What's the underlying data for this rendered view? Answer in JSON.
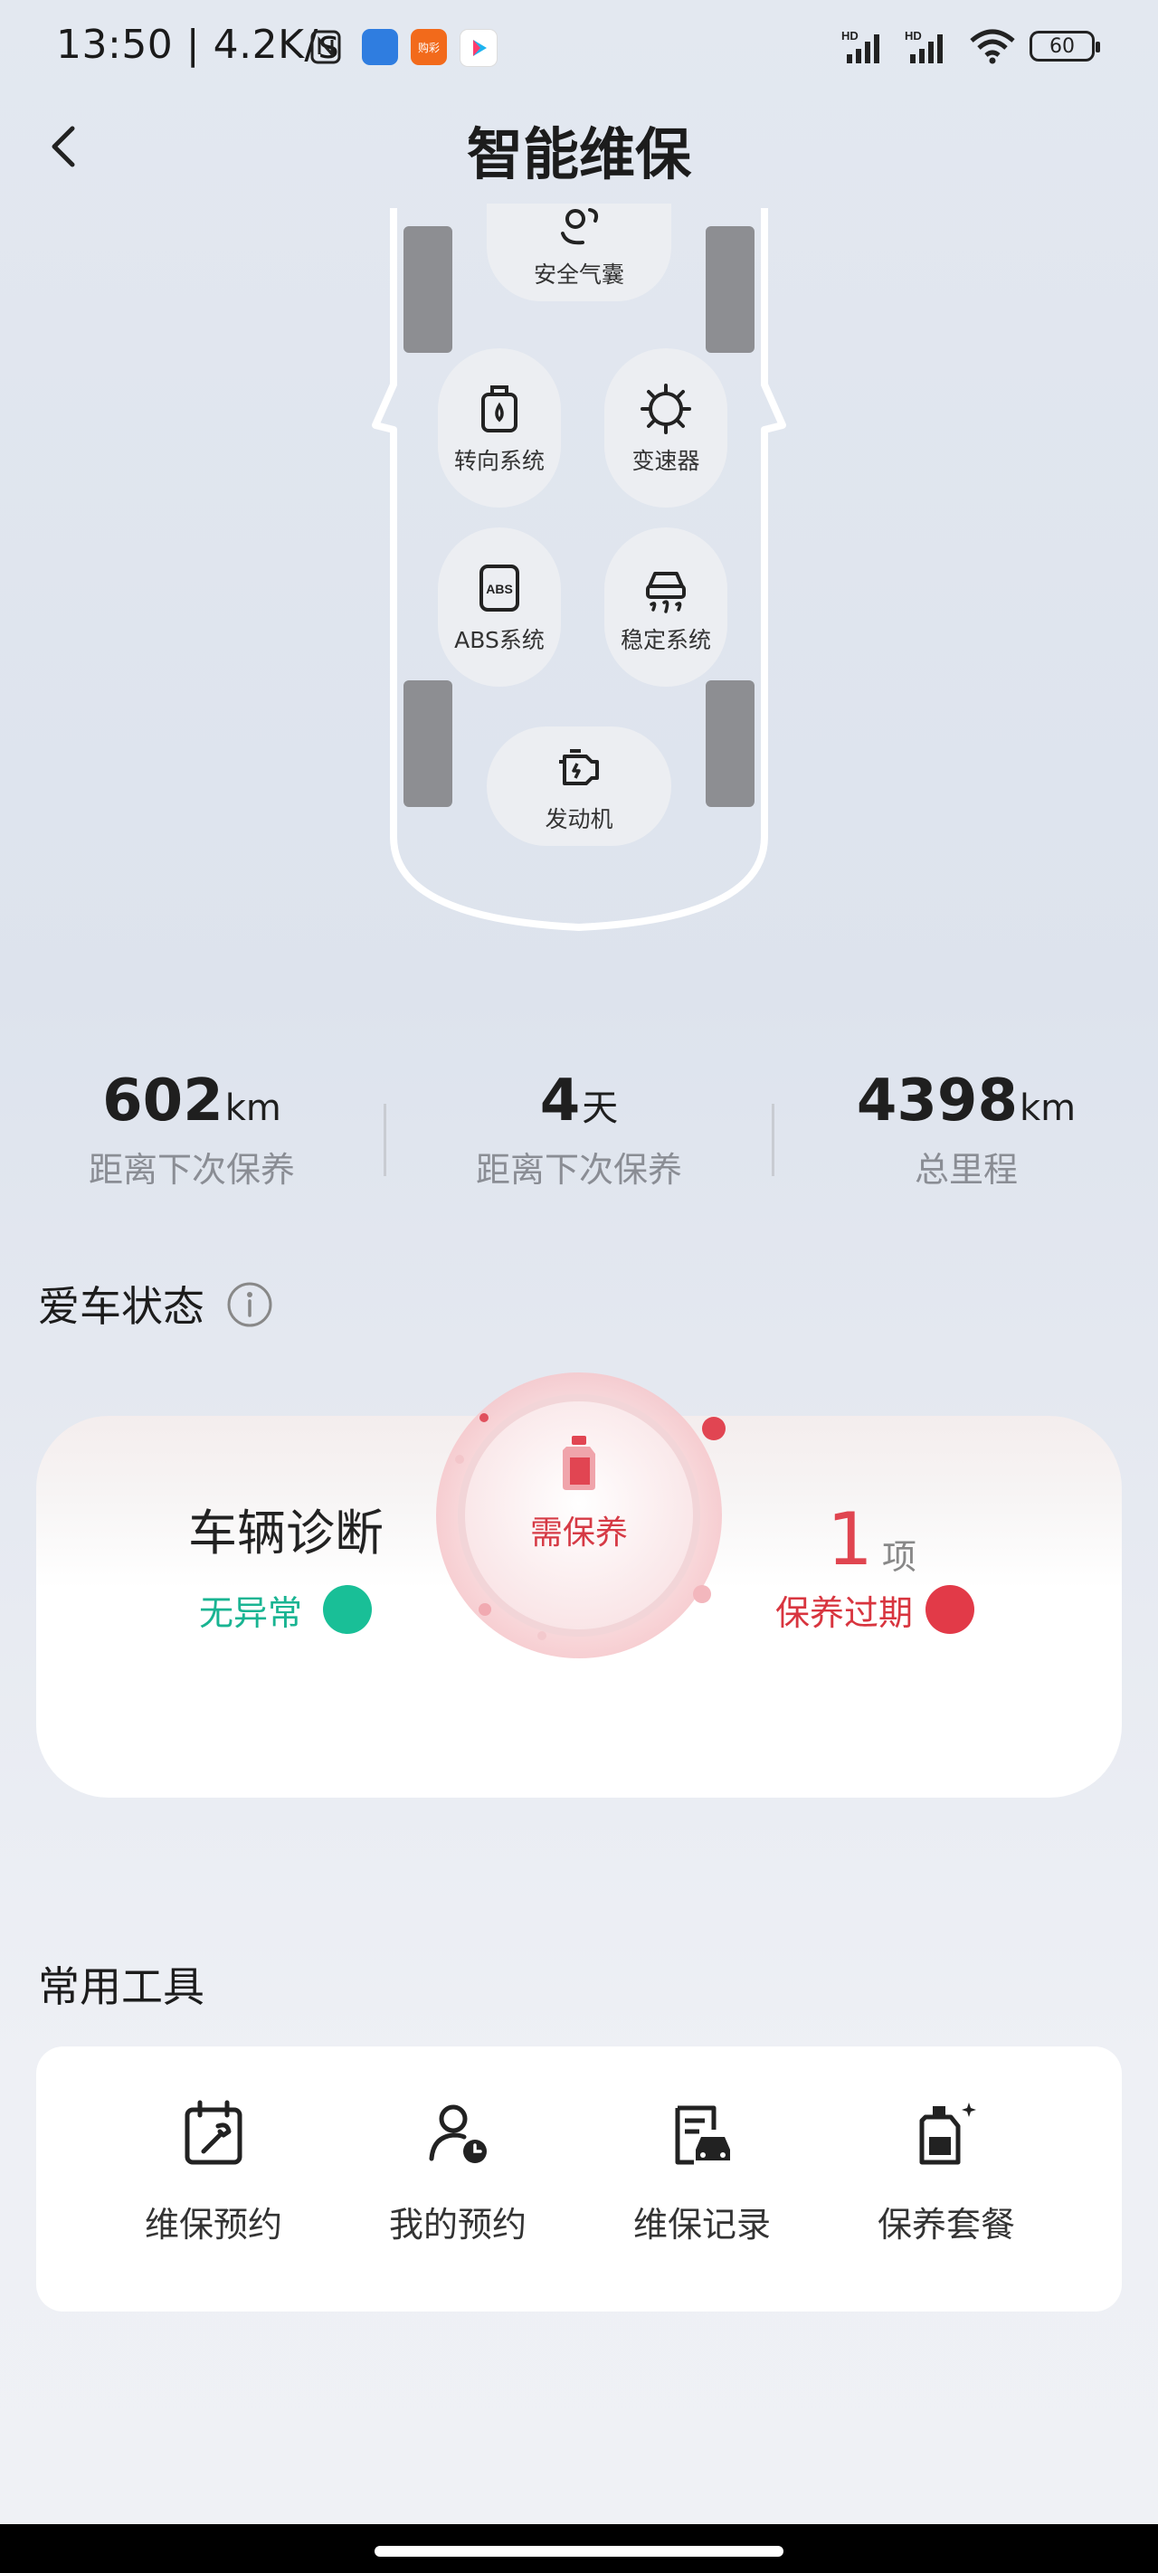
{
  "status_bar": {
    "time_speed": "13:50 | 4.2K/s",
    "app1": "",
    "app2": "购彩",
    "app3": "",
    "hd1": "HD",
    "hd2": "HD",
    "battery": "60",
    "icons": [
      "nfc-icon",
      "app-icon",
      "app-icon",
      "youku-icon",
      "signal-icon",
      "signal-icon",
      "wifi-icon",
      "battery-icon"
    ]
  },
  "header": {
    "title": "智能维保"
  },
  "car": {
    "airbag": "安全气囊",
    "steering": "转向系统",
    "gearbox": "变速器",
    "abs": "ABS系统",
    "abs_badge": "ABS",
    "stability": "稳定系统",
    "engine": "发动机"
  },
  "stats": [
    {
      "value": "602",
      "unit": "km",
      "label": "距离下次保养"
    },
    {
      "value": "4",
      "unit": "天",
      "label": "距离下次保养"
    },
    {
      "value": "4398",
      "unit": "km",
      "label": "总里程"
    }
  ],
  "car_status": {
    "title": "爱车状态",
    "diag_title": "车辆诊断",
    "diag_status": "无异常",
    "center_label": "需保养",
    "count": "1",
    "count_unit": "项",
    "overdue": "保养过期",
    "colors": {
      "ok": "#19b492",
      "alert": "#e03a46"
    }
  },
  "tools": {
    "title": "常用工具",
    "items": [
      {
        "label": "维保预约",
        "icon": "wrench-calendar-icon"
      },
      {
        "label": "我的预约",
        "icon": "user-clock-icon"
      },
      {
        "label": "维保记录",
        "icon": "car-record-icon"
      },
      {
        "label": "保养套餐",
        "icon": "oil-sparkle-icon"
      }
    ]
  }
}
